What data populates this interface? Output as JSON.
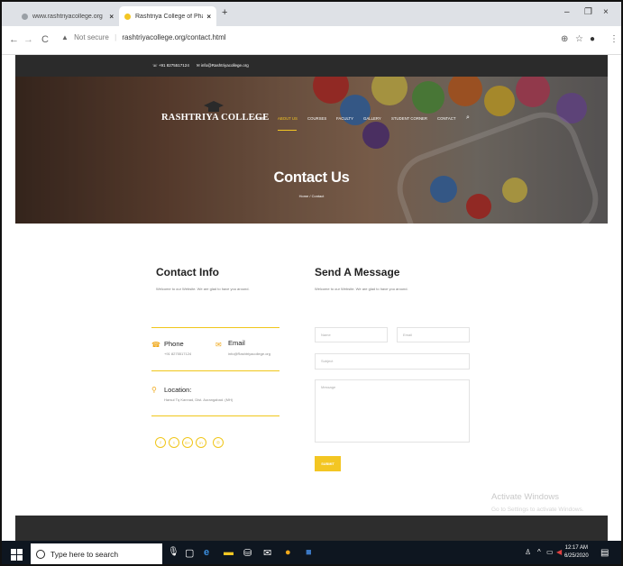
{
  "browser": {
    "tabs": [
      {
        "label": "www.rashtriyacollege.org",
        "close": "×",
        "active": false
      },
      {
        "label": "Rashtriya College of Pharmacy",
        "close": "×",
        "active": true
      }
    ],
    "new_tab": "+",
    "window_controls": {
      "minimize": "–",
      "maximize": "❐",
      "close": "×"
    },
    "nav": {
      "back": "←",
      "forward": "→",
      "reload": "C"
    },
    "address": {
      "security_icon": "▲",
      "security_text": "Not secure",
      "separator": "|",
      "url": "rashtriyacollege.org/contact.html"
    },
    "actions": {
      "zoom": "⊕",
      "star": "☆",
      "profile": "●",
      "menu": "⋮"
    }
  },
  "site": {
    "topbar": {
      "phone_icon": "☏",
      "phone": "+91 8275517124",
      "mail_icon": "✉",
      "email": "info@Rashtriyacollege.org"
    },
    "logo": "RASHTRIYA COLLEGE",
    "menu": [
      {
        "label": "HOME",
        "active": false
      },
      {
        "label": "ABOUT US",
        "active": true
      },
      {
        "label": "COURSES",
        "active": false
      },
      {
        "label": "FACULTY",
        "active": false
      },
      {
        "label": "GALLERY",
        "active": false
      },
      {
        "label": "STUDENT CORNER",
        "active": false
      },
      {
        "label": "CONTACT",
        "active": false
      }
    ],
    "search_icon": "⌕",
    "hero": {
      "title": "Contact Us",
      "breadcrumb": "Home / Contact"
    },
    "contact_info": {
      "title": "Contact Info",
      "intro": "Welcome to our Website. We are glad to have you around.",
      "phone": {
        "icon": "☎",
        "label": "Phone",
        "value": "+91 8275517124"
      },
      "email": {
        "icon": "✉",
        "label": "Email",
        "value": "info@Rashtriyacollege.org"
      },
      "location": {
        "icon": "⚲",
        "label": "Location:",
        "value": "Harsul Tq Kannad, Dist. Aurangabad. (MH)"
      },
      "social": [
        "f",
        "t",
        "G+",
        "in",
        "◎"
      ]
    },
    "message": {
      "title": "Send A Message",
      "intro": "Welcome to our Website. We are glad to have you around.",
      "name_placeholder": "Name",
      "email_placeholder": "Email",
      "subject_placeholder": "Subject",
      "message_placeholder": "Message",
      "submit": "SUBMIT"
    },
    "watermark": {
      "line1": "Activate Windows",
      "line2": "Go to Settings to activate Windows."
    }
  },
  "taskbar": {
    "search_placeholder": "Type here to search",
    "clock_time": "12:17 AM",
    "clock_date": "6/25/2020"
  },
  "colors": {
    "accent": "#f3c623",
    "dark": "#2b2b2b",
    "taskbar": "#0e1620"
  }
}
